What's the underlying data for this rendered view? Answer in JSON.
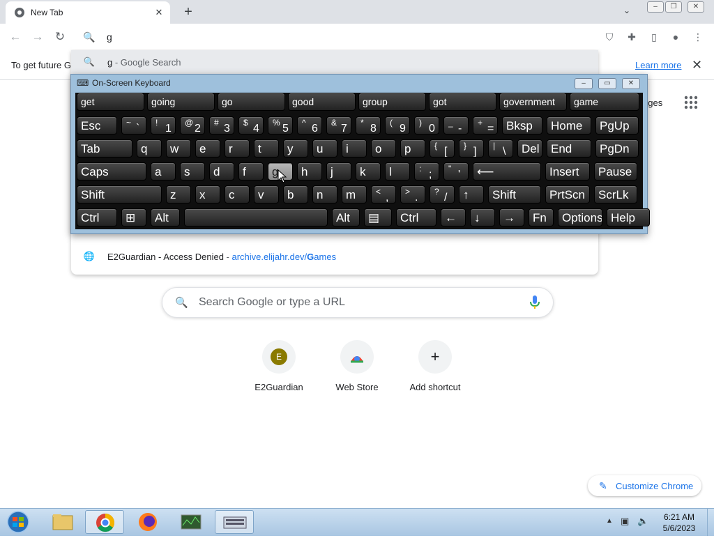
{
  "browser": {
    "tab_title": "New Tab",
    "tab_close": "✕",
    "new_tab": "+",
    "omnibox_value": "g",
    "infobar_text": "To get future G",
    "infobar_link": "Learn more",
    "images_link": "ages"
  },
  "suggestions": [
    {
      "type": "search",
      "text": "g",
      "sep": " - ",
      "rest": "Google Search"
    },
    {
      "type": "history",
      "text": "E2Guardian - Access Denied",
      "sep": " - ",
      "url_prefix": "archive.elijahr.dev/",
      "url_bold": "G",
      "url_rest": "ames"
    }
  ],
  "ntp": {
    "search_placeholder": "Search Google or type a URL",
    "shortcuts": [
      {
        "label": "E2Guardian",
        "initial": "E"
      },
      {
        "label": "Web Store",
        "initial": ""
      },
      {
        "label": "Add shortcut",
        "initial": "+"
      }
    ],
    "customize_label": "Customize Chrome"
  },
  "osk": {
    "title": "On-Screen Keyboard",
    "predictions": [
      "get",
      "going",
      "go",
      "good",
      "group",
      "got",
      "government",
      "game"
    ],
    "row1": [
      {
        "m": "Esc"
      },
      {
        "s": "~",
        "m": "`"
      },
      {
        "s": "!",
        "m": "1"
      },
      {
        "s": "@",
        "m": "2"
      },
      {
        "s": "#",
        "m": "3"
      },
      {
        "s": "$",
        "m": "4"
      },
      {
        "s": "%",
        "m": "5"
      },
      {
        "s": "^",
        "m": "6"
      },
      {
        "s": "&",
        "m": "7"
      },
      {
        "s": "*",
        "m": "8"
      },
      {
        "s": "(",
        "m": "9"
      },
      {
        "s": ")",
        "m": "0"
      },
      {
        "s": "_",
        "m": "-"
      },
      {
        "s": "+",
        "m": "="
      },
      {
        "m": "Bksp"
      },
      {
        "m": "Home"
      },
      {
        "m": "PgUp"
      }
    ],
    "row2": [
      {
        "m": "Tab"
      },
      {
        "m": "q"
      },
      {
        "m": "w"
      },
      {
        "m": "e"
      },
      {
        "m": "r"
      },
      {
        "m": "t"
      },
      {
        "m": "y"
      },
      {
        "m": "u"
      },
      {
        "m": "i"
      },
      {
        "m": "o"
      },
      {
        "m": "p"
      },
      {
        "s": "{",
        "m": "["
      },
      {
        "s": "}",
        "m": "]"
      },
      {
        "s": "|",
        "m": "\\"
      },
      {
        "m": "Del"
      },
      {
        "m": "End"
      },
      {
        "m": "PgDn"
      }
    ],
    "row3": [
      {
        "m": "Caps"
      },
      {
        "m": "a"
      },
      {
        "m": "s"
      },
      {
        "m": "d"
      },
      {
        "m": "f"
      },
      {
        "m": "g"
      },
      {
        "m": "h"
      },
      {
        "m": "j"
      },
      {
        "m": "k"
      },
      {
        "m": "l"
      },
      {
        "s": ":",
        "m": ";"
      },
      {
        "s": "\"",
        "m": "'"
      },
      {
        "m": "⟵"
      },
      {
        "m": "Insert"
      },
      {
        "m": "Pause"
      }
    ],
    "row4": [
      {
        "m": "Shift"
      },
      {
        "m": "z"
      },
      {
        "m": "x"
      },
      {
        "m": "c"
      },
      {
        "m": "v"
      },
      {
        "m": "b"
      },
      {
        "m": "n"
      },
      {
        "m": "m"
      },
      {
        "s": "<",
        "m": ","
      },
      {
        "s": ">",
        "m": "."
      },
      {
        "s": "?",
        "m": "/"
      },
      {
        "m": "↑"
      },
      {
        "m": "Shift"
      },
      {
        "m": "PrtScn"
      },
      {
        "m": "ScrLk"
      }
    ],
    "row5": [
      {
        "m": "Ctrl"
      },
      {
        "m": "⊞"
      },
      {
        "m": "Alt"
      },
      {
        "m": ""
      },
      {
        "m": "Alt"
      },
      {
        "m": "▤"
      },
      {
        "m": "Ctrl"
      },
      {
        "m": "←"
      },
      {
        "m": "↓"
      },
      {
        "m": "→"
      },
      {
        "m": "Fn"
      },
      {
        "m": "Options"
      },
      {
        "m": "Help"
      }
    ]
  },
  "taskbar": {
    "time": "6:21 AM",
    "date": "5/6/2023"
  },
  "colors": {
    "accent": "#1a73e8",
    "osk_frame": "#9ec0dc",
    "key_bg": "#2b2b2b"
  }
}
